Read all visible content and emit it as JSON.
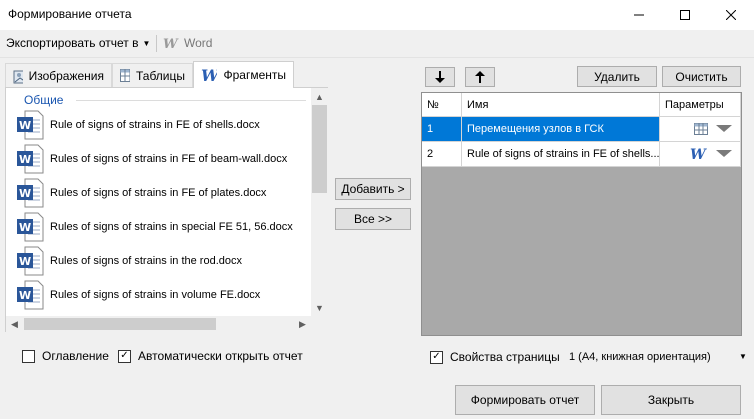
{
  "window": {
    "title": "Формирование отчета"
  },
  "toolbar": {
    "export_label": "Экспортировать отчет в",
    "word_label": "Word"
  },
  "tabs": [
    {
      "label": "Изображения",
      "icon": "images-icon"
    },
    {
      "label": "Таблицы",
      "icon": "table-icon"
    },
    {
      "label": "Фрагменты",
      "icon": "word-icon",
      "active": true
    }
  ],
  "fragments": {
    "group": "Общие",
    "items": [
      "Rule of signs of strains in FE of shells.docx",
      "Rules of signs of strains in FE of beam-wall.docx",
      "Rules of signs of strains in FE of plates.docx",
      "Rules of signs of strains in special FE 51, 56.docx",
      "Rules of signs of strains in the rod.docx",
      "Rules of signs of strains in volume FE.docx"
    ]
  },
  "buttons": {
    "add": "Добавить >",
    "all": "Все >>",
    "delete": "Удалить",
    "clear": "Очистить",
    "generate": "Формировать отчет",
    "close": "Закрыть"
  },
  "grid": {
    "headers": {
      "num": "№",
      "name": "Имя",
      "params": "Параметры"
    },
    "rows": [
      {
        "num": "1",
        "name": "Перемещения узлов в ГСК",
        "param_icon": "table-icon",
        "selected": true
      },
      {
        "num": "2",
        "name": "Rule of signs of strains in FE of shells....",
        "param_icon": "word-icon",
        "selected": false
      }
    ]
  },
  "options": {
    "toc_label": "Оглавление",
    "toc_checked": false,
    "autoopen_label": "Автоматически открыть отчет",
    "autoopen_checked": true,
    "pageprops_label": "Свойства страницы",
    "pageprops_checked": true,
    "page_value": "1 (А4, книжная ориентация)"
  },
  "colors": {
    "selection": "#0078d7",
    "group_label": "#1a56b0",
    "grid_bg": "#a9a9a9"
  }
}
